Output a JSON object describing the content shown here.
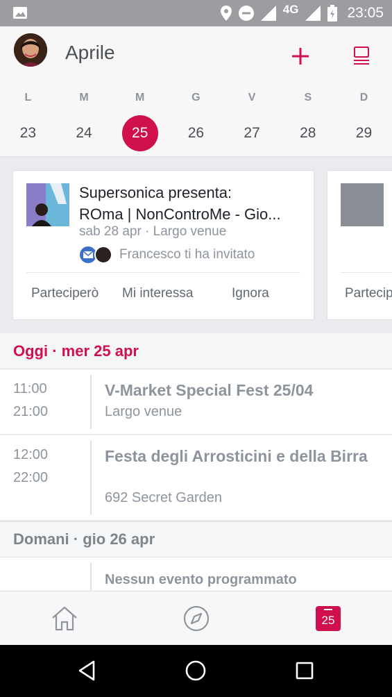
{
  "status_bar": {
    "network": "4G",
    "time": "23:05"
  },
  "header": {
    "month": "Aprile"
  },
  "week": {
    "days": [
      "L",
      "M",
      "M",
      "G",
      "V",
      "S",
      "D"
    ],
    "dates": [
      "23",
      "24",
      "25",
      "26",
      "27",
      "28",
      "29"
    ],
    "selected_index": 2
  },
  "featured": {
    "title_line1": "Supersonica presenta:",
    "title_line2": "ROma | NonControMe - Gio...",
    "meta": "sab 28 apr · Largo venue",
    "invite": "Francesco ti ha invitato",
    "actions": {
      "going": "Parteciperò",
      "interested": "Mi interessa",
      "ignore": "Ignora"
    },
    "next_card_action": "Partecipe"
  },
  "today": {
    "heading": "Oggi · mer 25 apr",
    "events": [
      {
        "start": "11:00",
        "end": "21:00",
        "title": "V-Market Special Fest 25/04",
        "place": "Largo venue"
      },
      {
        "start": "12:00",
        "end": "22:00",
        "title": "Festa degli Arrosticini e della Birra",
        "place": "692 Secret Garden"
      }
    ]
  },
  "tomorrow": {
    "heading": "Domani · gio 26 apr",
    "empty_text": "Nessun evento programmato"
  },
  "bottom_nav": {
    "calendar_day": "25"
  },
  "colors": {
    "accent": "#d0104c",
    "text": "#4b4f56",
    "muted": "#8d949e"
  }
}
